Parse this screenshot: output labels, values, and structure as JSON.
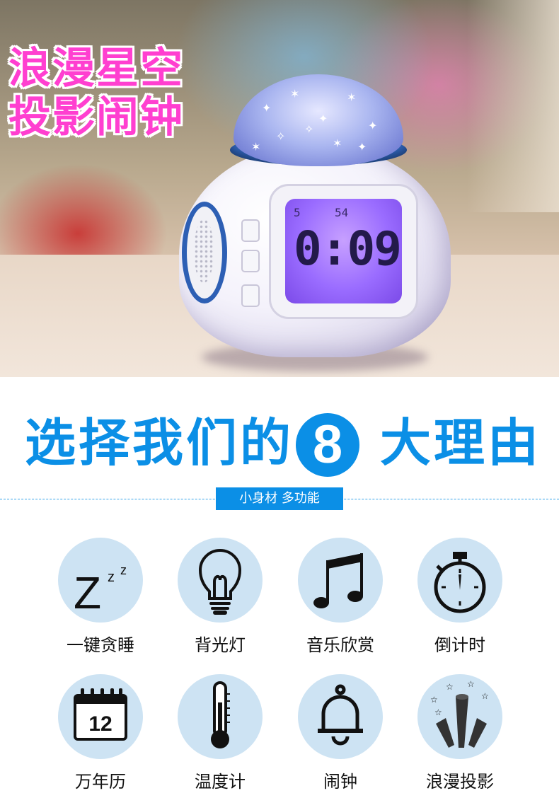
{
  "hero": {
    "title_line1": "浪漫星空",
    "title_line2": "投影闹钟",
    "clock_display": {
      "seconds_label": "5",
      "small_digits": "54",
      "time": "0:09"
    }
  },
  "headline": {
    "left": "选择我们的",
    "number": "8",
    "right": "大理由"
  },
  "tag": "小身材 多功能",
  "features": [
    {
      "label": "一键贪睡",
      "icon": "snooze-icon",
      "icon_text": "Z",
      "icon_small": "z z"
    },
    {
      "label": "背光灯",
      "icon": "light-bulb-icon"
    },
    {
      "label": "音乐欣赏",
      "icon": "music-note-icon"
    },
    {
      "label": "倒计时",
      "icon": "stopwatch-icon"
    },
    {
      "label": "万年历",
      "icon": "calendar-icon",
      "icon_text": "12"
    },
    {
      "label": "温度计",
      "icon": "thermometer-icon"
    },
    {
      "label": "闹钟",
      "icon": "alarm-bell-icon"
    },
    {
      "label": "浪漫投影",
      "icon": "star-projection-icon"
    }
  ],
  "colors": {
    "accent_blue": "#0b8fe6",
    "circle_bg": "#cde3f3",
    "title_pink": "#ff3fd0"
  }
}
